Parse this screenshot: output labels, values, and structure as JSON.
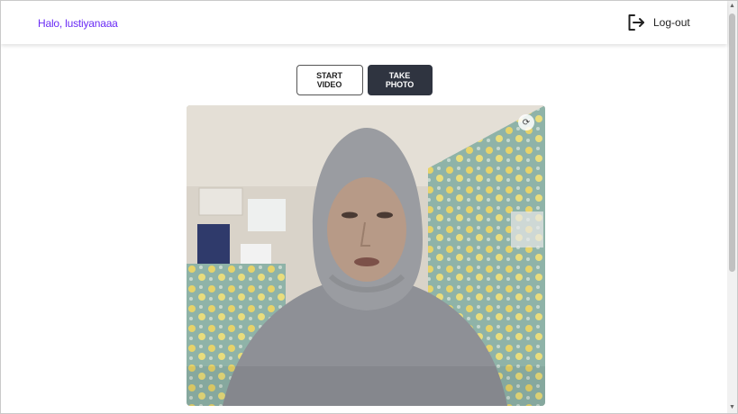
{
  "navbar": {
    "greeting": "Halo, lustiyanaaa",
    "logout_label": "Log-out",
    "logout_icon": "logout-icon"
  },
  "controls": {
    "start_video_label": "START VIDEO",
    "take_photo_label": "TAKE PHOTO"
  },
  "video": {
    "content": "live-camera-feed",
    "overlay_icon": "camera-switch-icon"
  },
  "colors": {
    "greeting_text": "#6b2cf5",
    "dark_button": "#2f3440",
    "outline_button_border": "#555555"
  }
}
